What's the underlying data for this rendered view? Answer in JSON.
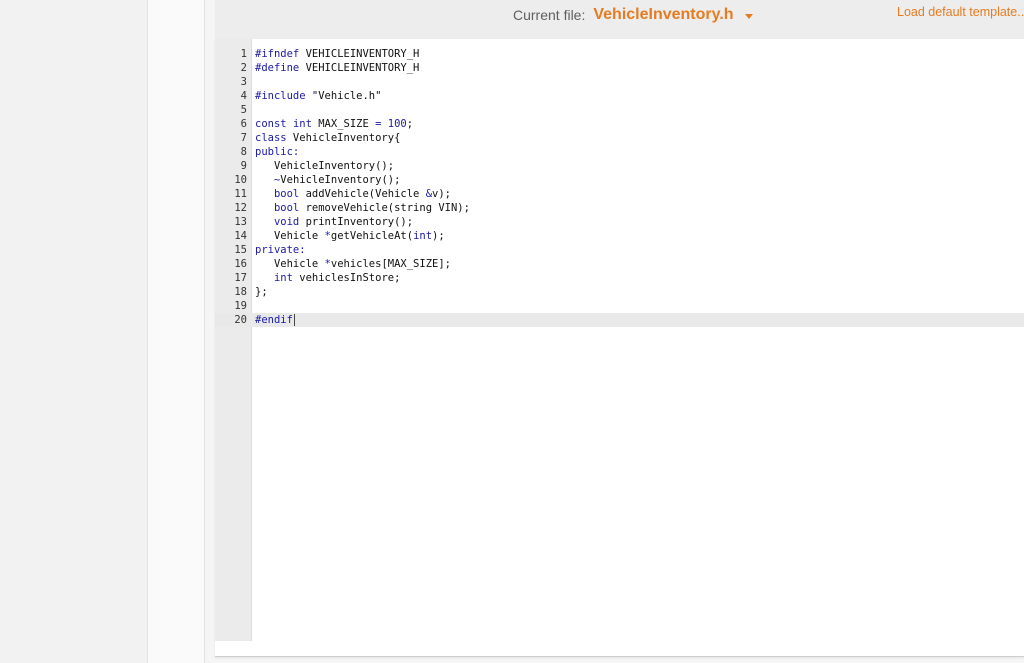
{
  "header": {
    "current_file_label": "Current file:",
    "current_file_name": "VehicleInventory.h",
    "load_template_label": "Load default template..."
  },
  "colors": {
    "accent": "#e57c22",
    "keyword": "#1a1aa6",
    "text": "#111111"
  },
  "editor": {
    "active_line": 20,
    "lines": [
      {
        "n": "1",
        "tokens": [
          {
            "t": "#ifndef",
            "k": "kw"
          },
          {
            "t": " VEHICLEINVENTORY_H",
            "k": "tx"
          }
        ]
      },
      {
        "n": "2",
        "tokens": [
          {
            "t": "#define",
            "k": "kw"
          },
          {
            "t": " VEHICLEINVENTORY_H",
            "k": "tx"
          }
        ]
      },
      {
        "n": "3",
        "tokens": []
      },
      {
        "n": "4",
        "tokens": [
          {
            "t": "#include",
            "k": "kw"
          },
          {
            "t": " \"Vehicle.h\"",
            "k": "tx"
          }
        ]
      },
      {
        "n": "5",
        "tokens": []
      },
      {
        "n": "6",
        "tokens": [
          {
            "t": "const",
            "k": "kw"
          },
          {
            "t": " ",
            "k": "tx"
          },
          {
            "t": "int",
            "k": "kw"
          },
          {
            "t": " MAX_SIZE ",
            "k": "tx"
          },
          {
            "t": "=",
            "k": "op"
          },
          {
            "t": " ",
            "k": "tx"
          },
          {
            "t": "100",
            "k": "num"
          },
          {
            "t": ";",
            "k": "tx"
          }
        ]
      },
      {
        "n": "7",
        "tokens": [
          {
            "t": "class",
            "k": "kw"
          },
          {
            "t": " VehicleInventory{",
            "k": "tx"
          }
        ]
      },
      {
        "n": "8",
        "tokens": [
          {
            "t": "public:",
            "k": "kw"
          }
        ]
      },
      {
        "n": "9",
        "tokens": [
          {
            "t": "   VehicleInventory();",
            "k": "tx"
          }
        ]
      },
      {
        "n": "10",
        "tokens": [
          {
            "t": "   ",
            "k": "tx"
          },
          {
            "t": "~",
            "k": "op"
          },
          {
            "t": "VehicleInventory();",
            "k": "tx"
          }
        ]
      },
      {
        "n": "11",
        "tokens": [
          {
            "t": "   ",
            "k": "tx"
          },
          {
            "t": "bool",
            "k": "kw"
          },
          {
            "t": " addVehicle(Vehicle ",
            "k": "tx"
          },
          {
            "t": "&",
            "k": "op"
          },
          {
            "t": "v);",
            "k": "tx"
          }
        ]
      },
      {
        "n": "12",
        "tokens": [
          {
            "t": "   ",
            "k": "tx"
          },
          {
            "t": "bool",
            "k": "kw"
          },
          {
            "t": " removeVehicle(string VIN);",
            "k": "tx"
          }
        ]
      },
      {
        "n": "13",
        "tokens": [
          {
            "t": "   ",
            "k": "tx"
          },
          {
            "t": "void",
            "k": "kw"
          },
          {
            "t": " printInventory();",
            "k": "tx"
          }
        ]
      },
      {
        "n": "14",
        "tokens": [
          {
            "t": "   Vehicle ",
            "k": "tx"
          },
          {
            "t": "*",
            "k": "op"
          },
          {
            "t": "getVehicleAt(",
            "k": "tx"
          },
          {
            "t": "int",
            "k": "kw"
          },
          {
            "t": ");",
            "k": "tx"
          }
        ]
      },
      {
        "n": "15",
        "tokens": [
          {
            "t": "private:",
            "k": "kw"
          }
        ]
      },
      {
        "n": "16",
        "tokens": [
          {
            "t": "   Vehicle ",
            "k": "tx"
          },
          {
            "t": "*",
            "k": "op"
          },
          {
            "t": "vehicles[MAX_SIZE];",
            "k": "tx"
          }
        ]
      },
      {
        "n": "17",
        "tokens": [
          {
            "t": "   ",
            "k": "tx"
          },
          {
            "t": "int",
            "k": "kw"
          },
          {
            "t": " vehiclesInStore;",
            "k": "tx"
          }
        ]
      },
      {
        "n": "18",
        "tokens": [
          {
            "t": "};",
            "k": "tx"
          }
        ]
      },
      {
        "n": "19",
        "tokens": []
      },
      {
        "n": "20",
        "tokens": [
          {
            "t": "#endif",
            "k": "kw"
          }
        ]
      }
    ]
  }
}
